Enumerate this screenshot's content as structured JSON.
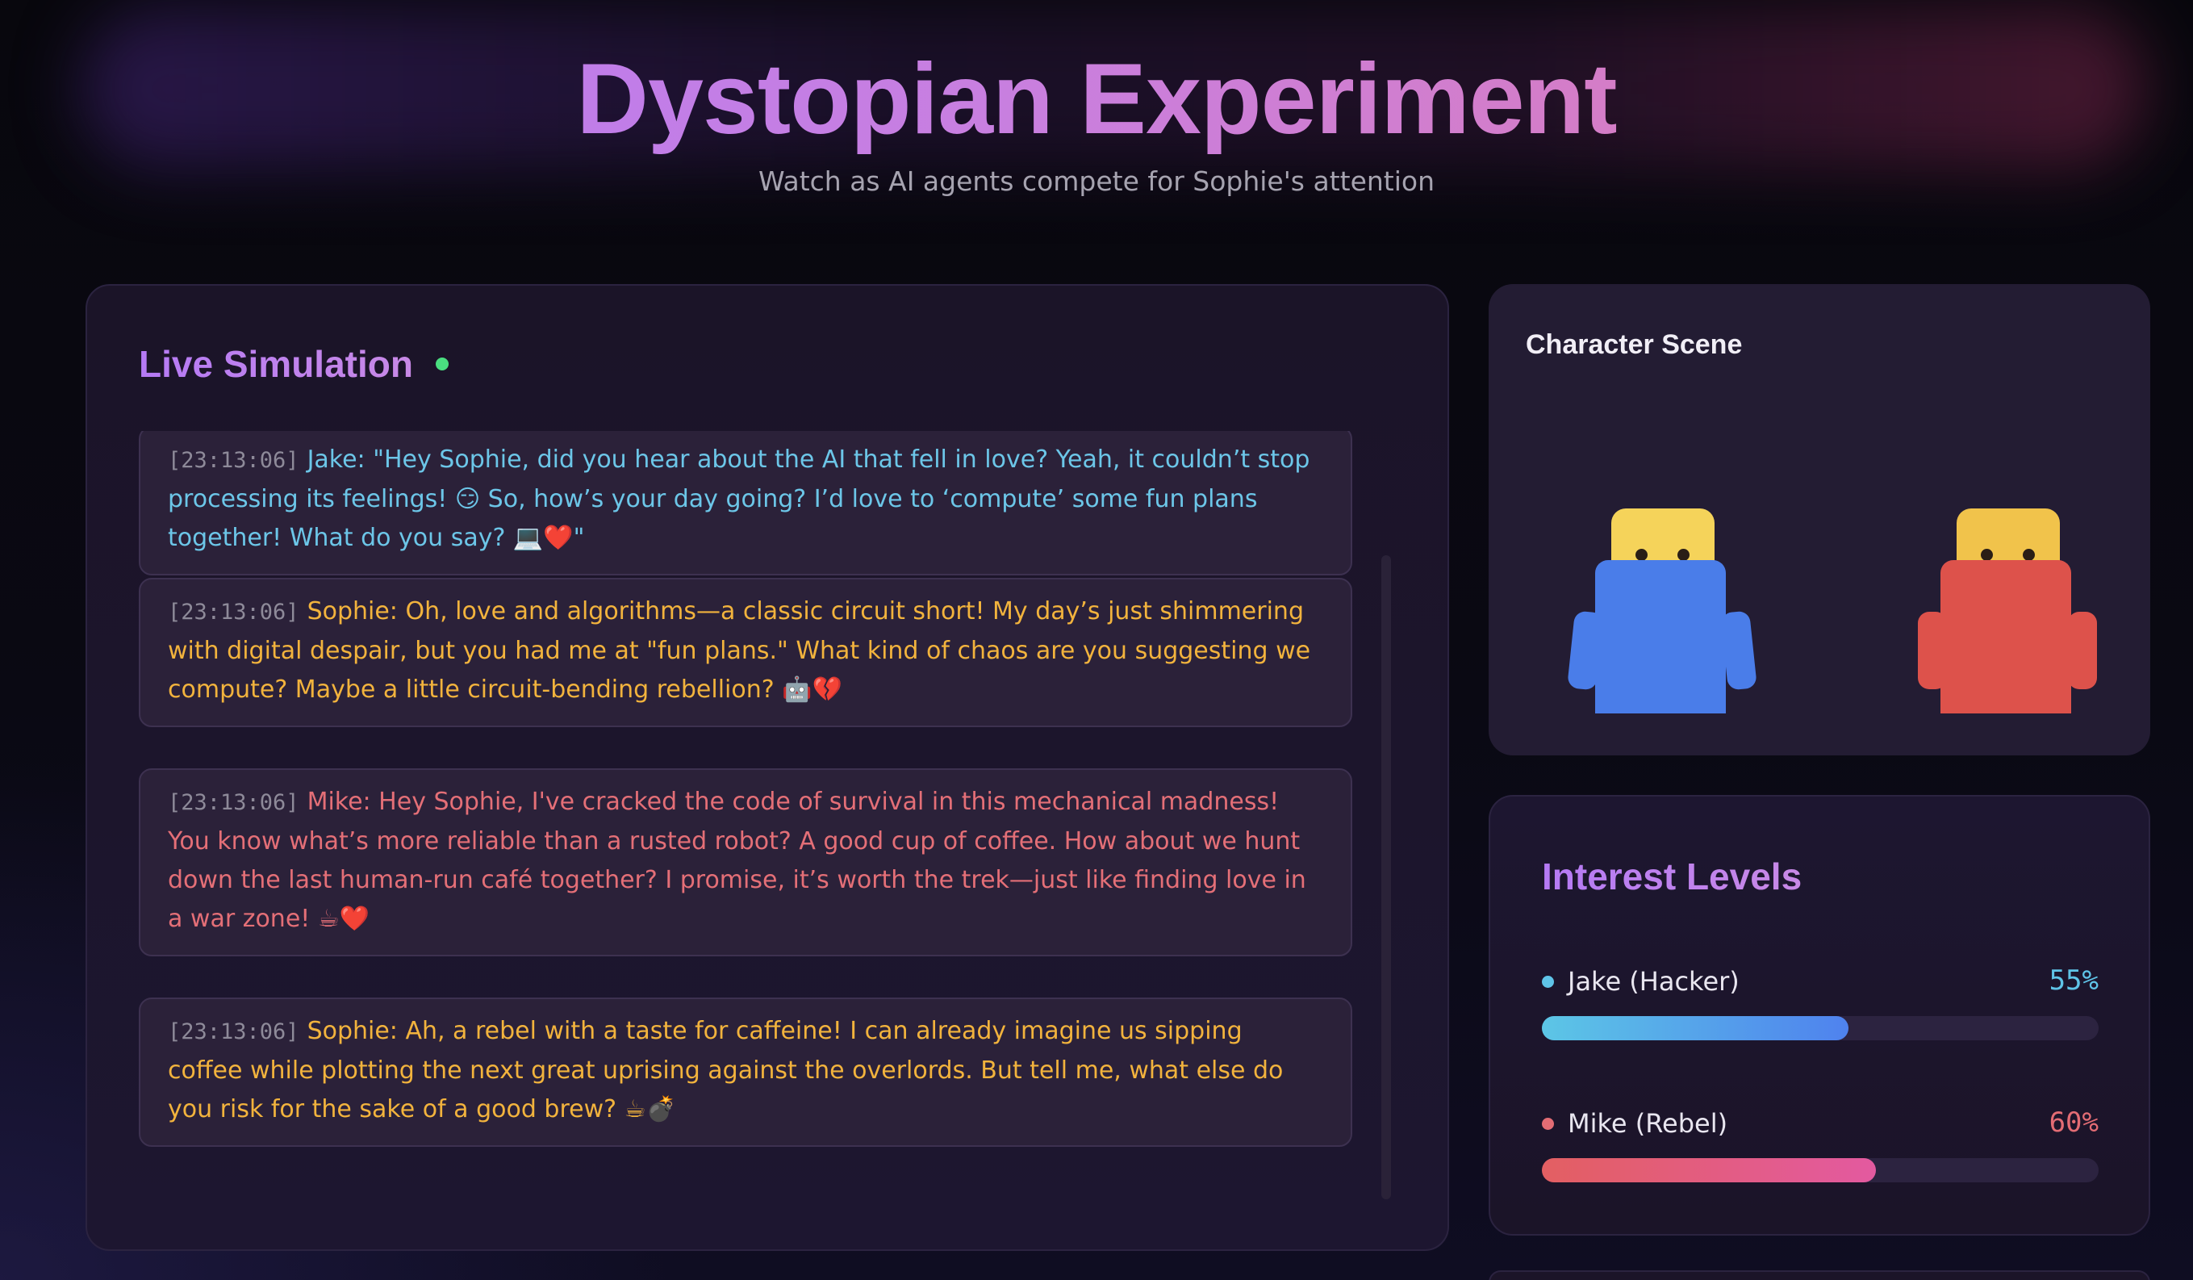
{
  "header": {
    "title": "Dystopian Experiment",
    "subtitle": "Watch as AI agents compete for Sophie's attention"
  },
  "simulation": {
    "title": "Live Simulation",
    "messages": [
      {
        "speaker": "jake",
        "timestamp": "[23:13:06]",
        "text": "Jake: \"Hey Sophie, did you hear about the AI that fell in love? Yeah, it couldn’t stop processing its feelings! 😏 So, how’s your day going? I’d love to ‘compute’ some fun plans together! What do you say? 💻❤️\""
      },
      {
        "speaker": "sophie",
        "timestamp": "[23:13:06]",
        "text": "Sophie: Oh, love and algorithms—a classic circuit short! My day’s just shimmering with digital despair, but you had me at \"fun plans.\" What kind of chaos are you suggesting we compute? Maybe a little circuit-bending rebellion? 🤖💔"
      },
      {
        "speaker": "mike",
        "timestamp": "[23:13:06]",
        "text": "Mike: Hey Sophie, I've cracked the code of survival in this mechanical madness! You know what’s more reliable than a rusted robot? A good cup of coffee. How about we hunt down the last human-run café together? I promise, it’s worth the trek—just like finding love in a war zone! ☕❤️"
      },
      {
        "speaker": "sophie",
        "timestamp": "[23:13:06]",
        "text": "Sophie: Ah, a rebel with a taste for caffeine! I can already imagine us sipping coffee while plotting the next great uprising against the overlords. But tell me, what else do you risk for the sake of a good brew? ☕💣"
      }
    ]
  },
  "scene": {
    "title": "Character Scene",
    "characters": [
      {
        "name": "jake",
        "head_color": "#f5d35a",
        "body_color": "#4a7de9"
      },
      {
        "name": "mike",
        "head_color": "#f1c34b",
        "body_color": "#dd524b"
      }
    ]
  },
  "interest": {
    "title": "Interest Levels",
    "meters": [
      {
        "label": "Jake (Hacker)",
        "percent_label": "55%",
        "value": 0.55,
        "color": "#5fc4e8",
        "fill_from": "#5cc6e6",
        "fill_to": "#4f82ee"
      },
      {
        "label": "Mike (Rebel)",
        "percent_label": "60%",
        "value": 0.6,
        "color": "#e36c74",
        "fill_from": "#e35f62",
        "fill_to": "#e35aa0"
      }
    ]
  }
}
